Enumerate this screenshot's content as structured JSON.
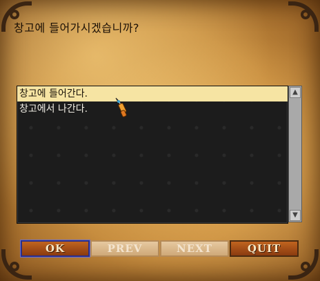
{
  "dialog": {
    "question": "창고에 들어가시겠습니까?"
  },
  "list": {
    "items": [
      {
        "label": "창고에 들어간다.",
        "selected": true
      },
      {
        "label": "창고에서 나간다.",
        "selected": false
      }
    ]
  },
  "scrollbar": {
    "up_icon": "▲",
    "down_icon": "▼"
  },
  "buttons": {
    "ok": "OK",
    "prev": "PREV",
    "next": "NEXT",
    "quit": "QUIT"
  },
  "colors": {
    "selected_row": "#f6e4a3",
    "list_background": "#1c1c1c",
    "button": "#a84e18"
  }
}
